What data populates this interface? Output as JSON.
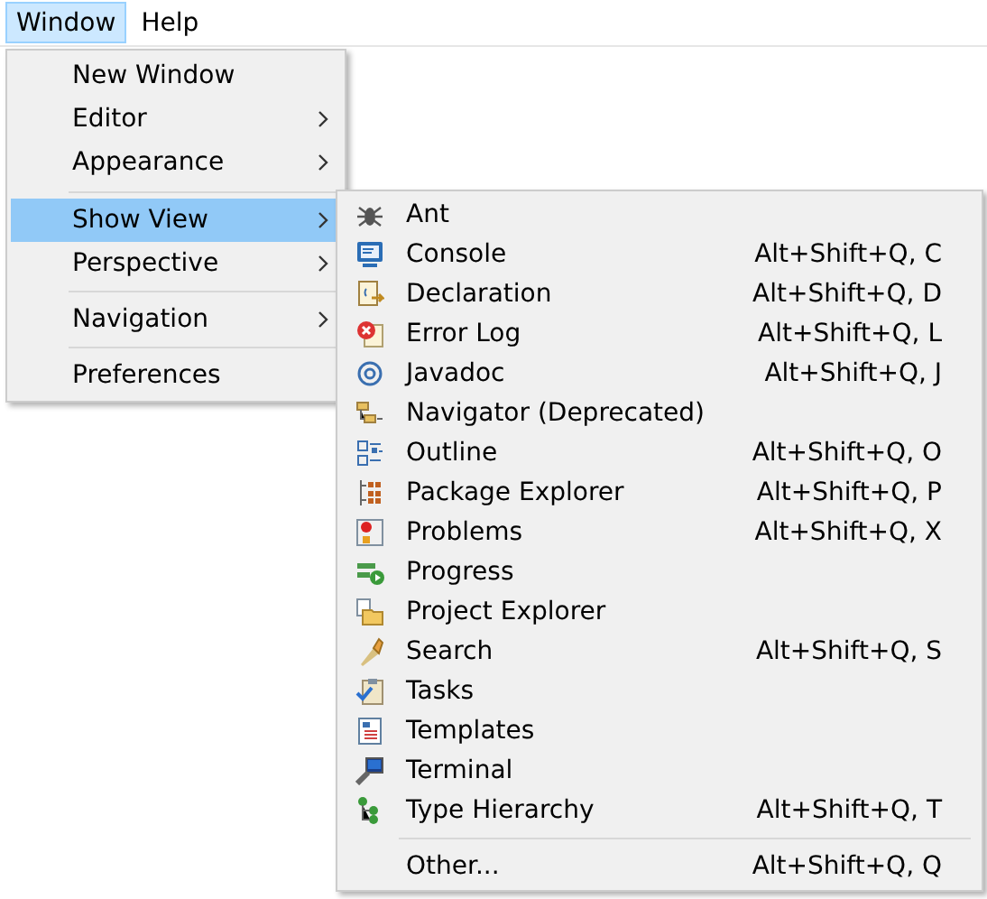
{
  "menubar": [
    {
      "label": "Window",
      "selected": true
    },
    {
      "label": "Help",
      "selected": false
    }
  ],
  "menu": [
    {
      "kind": "item",
      "label": "New Window",
      "submenu": false,
      "selected": false
    },
    {
      "kind": "item",
      "label": "Editor",
      "submenu": true,
      "selected": false
    },
    {
      "kind": "item",
      "label": "Appearance",
      "submenu": true,
      "selected": false
    },
    {
      "kind": "separator"
    },
    {
      "kind": "item",
      "label": "Show View",
      "submenu": true,
      "selected": true
    },
    {
      "kind": "item",
      "label": "Perspective",
      "submenu": true,
      "selected": false
    },
    {
      "kind": "separator"
    },
    {
      "kind": "item",
      "label": "Navigation",
      "submenu": true,
      "selected": false
    },
    {
      "kind": "separator"
    },
    {
      "kind": "item",
      "label": "Preferences",
      "submenu": false,
      "selected": false
    }
  ],
  "submenu": [
    {
      "kind": "item",
      "label": "Ant"
    },
    {
      "kind": "item",
      "label": "Console",
      "shortcut": "Alt+Shift+Q, C"
    },
    {
      "kind": "item",
      "label": "Declaration",
      "shortcut": "Alt+Shift+Q, D"
    },
    {
      "kind": "item",
      "label": "Error Log",
      "shortcut": "Alt+Shift+Q, L"
    },
    {
      "kind": "item",
      "label": "Javadoc",
      "shortcut": "Alt+Shift+Q, J"
    },
    {
      "kind": "item",
      "label": "Navigator (Deprecated)"
    },
    {
      "kind": "item",
      "label": "Outline",
      "shortcut": "Alt+Shift+Q, O"
    },
    {
      "kind": "item",
      "label": "Package Explorer",
      "shortcut": "Alt+Shift+Q, P"
    },
    {
      "kind": "item",
      "label": "Problems",
      "shortcut": "Alt+Shift+Q, X"
    },
    {
      "kind": "item",
      "label": "Progress"
    },
    {
      "kind": "item",
      "label": "Project Explorer"
    },
    {
      "kind": "item",
      "label": "Search",
      "shortcut": "Alt+Shift+Q, S"
    },
    {
      "kind": "item",
      "label": "Tasks"
    },
    {
      "kind": "item",
      "label": "Templates"
    },
    {
      "kind": "item",
      "label": "Terminal"
    },
    {
      "kind": "item",
      "label": "Type Hierarchy",
      "shortcut": "Alt+Shift+Q, T"
    },
    {
      "kind": "separator"
    },
    {
      "kind": "item",
      "label": "Other...",
      "shortcut": "Alt+Shift+Q, Q"
    }
  ]
}
